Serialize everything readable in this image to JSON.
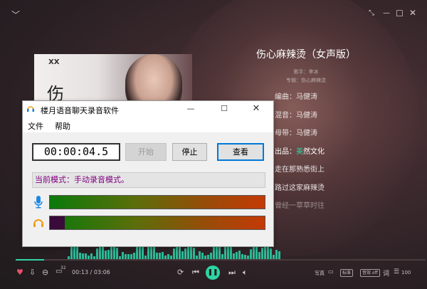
{
  "player": {
    "song_title": "伤心麻辣烫（女声版）",
    "singer": "歌手：李冰",
    "album": "专辑：伤心麻辣烫",
    "album_art_text": "伤",
    "lyrics": [
      "编曲：马健涛",
      "混音：马健涛",
      "母带：马健涛",
      "出品：美然文化",
      "走在那熟悉街上",
      "路过这家麻辣烫",
      "曾经一草草时往"
    ],
    "time": "00:13 / 03:06",
    "progress": 0.07,
    "badge_count": "32",
    "xiezhen": "写真",
    "quality": "标准",
    "effect": "音效 off",
    "lyric_btn": "词",
    "playlist_count": "100",
    "accent": "#2fd4a4"
  },
  "dialog": {
    "title": "楼月语音聊天录音软件",
    "menu": [
      "文件",
      "帮助"
    ],
    "timer": "00:00:04.5",
    "start": "开始",
    "stop": "停止",
    "view": "查看",
    "mode": "当前模式：手动录音模式。",
    "mic_level": 0.0,
    "speaker_level": 0.07
  }
}
